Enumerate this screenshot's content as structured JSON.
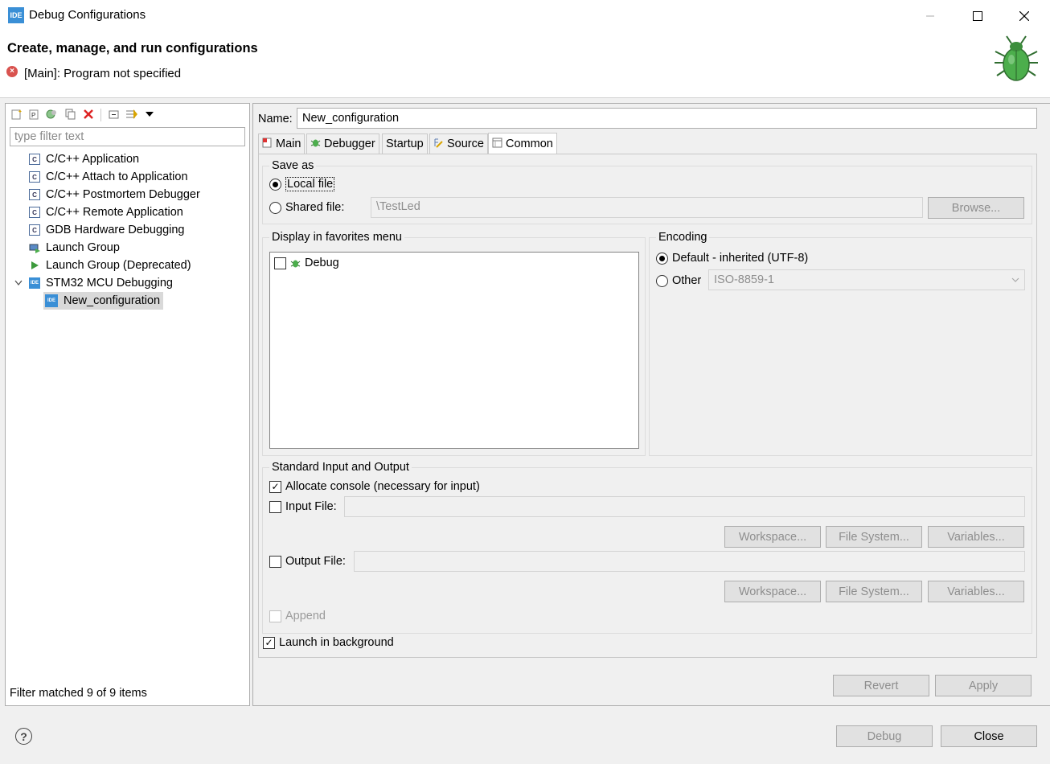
{
  "window": {
    "app_icon_text": "IDE",
    "title": "Debug Configurations"
  },
  "header": {
    "title": "Create, manage, and run configurations",
    "error_message": "[Main]: Program not specified"
  },
  "left_panel": {
    "filter_placeholder": "type filter text",
    "tree": [
      {
        "label": "C/C++ Application",
        "icon": "c-app-icon"
      },
      {
        "label": "C/C++ Attach to Application",
        "icon": "c-app-icon"
      },
      {
        "label": "C/C++ Postmortem Debugger",
        "icon": "c-app-icon"
      },
      {
        "label": "C/C++ Remote Application",
        "icon": "c-app-icon"
      },
      {
        "label": "GDB Hardware Debugging",
        "icon": "c-app-icon"
      },
      {
        "label": "Launch Group",
        "icon": "launch-group-icon"
      },
      {
        "label": "Launch Group (Deprecated)",
        "icon": "run-icon"
      },
      {
        "label": "STM32 MCU Debugging",
        "icon": "ide-icon"
      },
      {
        "label": "New_configuration",
        "icon": "ide-icon"
      }
    ],
    "status": "Filter matched 9 of 9 items"
  },
  "config": {
    "name_label": "Name:",
    "name_value": "New_configuration",
    "tabs": [
      "Main",
      "Debugger",
      "Startup",
      "Source",
      "Common"
    ],
    "active_tab": "Common",
    "save_as": {
      "legend": "Save as",
      "local_file": "Local file",
      "shared_file": "Shared file:",
      "shared_path": "\\TestLed",
      "browse": "Browse..."
    },
    "favorites": {
      "legend": "Display in favorites menu",
      "items": [
        "Debug"
      ]
    },
    "encoding": {
      "legend": "Encoding",
      "default": "Default - inherited (UTF-8)",
      "other": "Other",
      "other_value": "ISO-8859-1"
    },
    "std_io": {
      "legend": "Standard Input and Output",
      "allocate_console": "Allocate console (necessary for input)",
      "input_file": "Input File:",
      "output_file": "Output File:",
      "workspace": "Workspace...",
      "file_system": "File System...",
      "variables": "Variables...",
      "append": "Append"
    },
    "launch_background": "Launch in background",
    "revert": "Revert",
    "apply": "Apply"
  },
  "footer": {
    "debug": "Debug",
    "close": "Close"
  }
}
